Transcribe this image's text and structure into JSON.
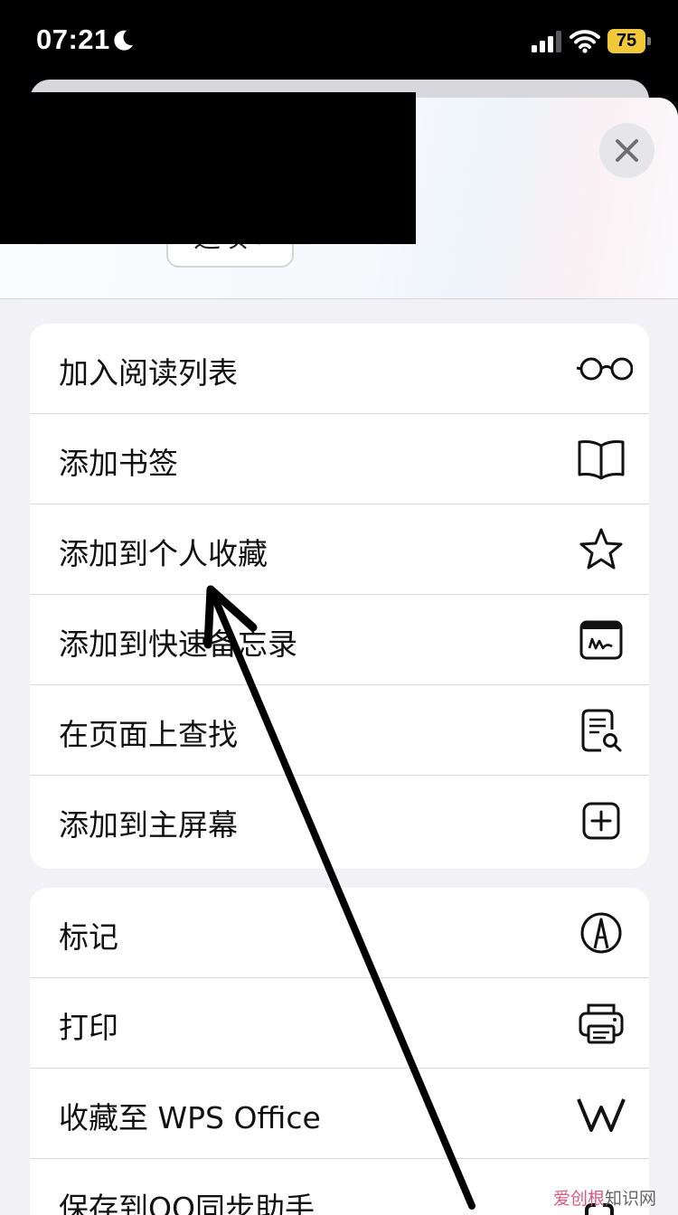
{
  "status_bar": {
    "time": "07:21",
    "battery": "75",
    "icons": [
      "moon-icon",
      "signal-icon",
      "wifi-icon",
      "battery-icon"
    ],
    "battery_color": "#f0c83a"
  },
  "sheet": {
    "options_label": "选项 ›",
    "close_icon": "close-icon"
  },
  "menu_group_1": [
    {
      "label": "加入阅读列表",
      "icon": "glasses-icon"
    },
    {
      "label": "添加书签",
      "icon": "book-icon"
    },
    {
      "label": "添加到个人收藏",
      "icon": "star-icon"
    },
    {
      "label": "添加到快速备忘录",
      "icon": "quick-note-icon"
    },
    {
      "label": "在页面上查找",
      "icon": "find-on-page-icon"
    },
    {
      "label": "添加到主屏幕",
      "icon": "add-square-icon"
    }
  ],
  "menu_group_2": [
    {
      "label": "标记",
      "icon": "markup-pen-icon"
    },
    {
      "label": "打印",
      "icon": "printer-icon"
    },
    {
      "label": "收藏至 WPS Office",
      "icon": "wps-office-icon"
    },
    {
      "label": "保存到QQ同步助手",
      "icon": "qq-sync-icon"
    }
  ],
  "watermark": {
    "brand": "爱创根",
    "site": "知识网"
  }
}
